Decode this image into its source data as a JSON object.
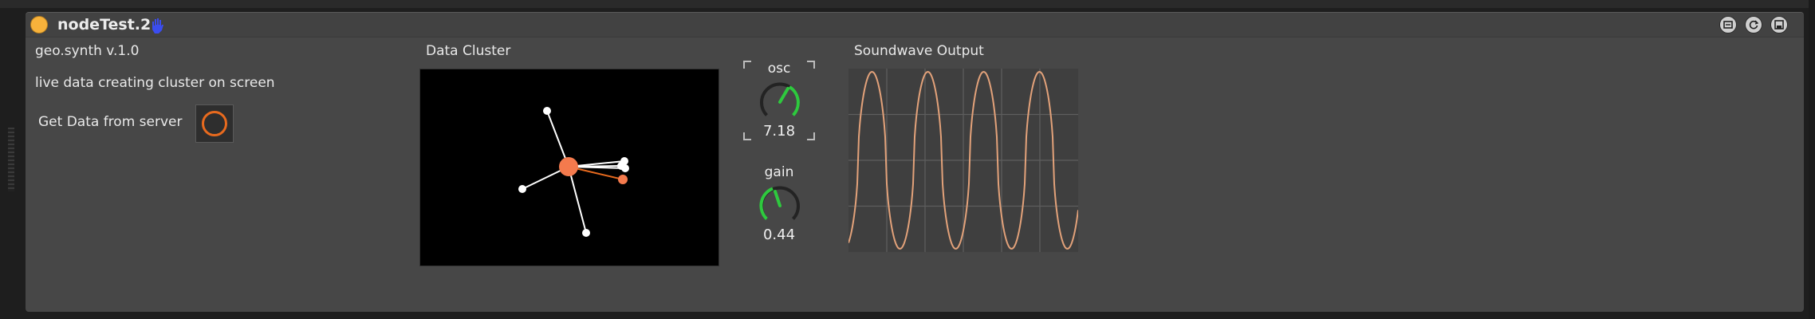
{
  "device": {
    "title": "nodeTest.2",
    "colors": {
      "power": "#f7b23b",
      "accent": "#e86a1e",
      "knob_arc": "#2ec93e",
      "wave": "#e3a27a"
    }
  },
  "info": {
    "name": "geo.synth v.1.0",
    "description": "live data creating cluster on screen",
    "get_data_label": "Get Data from server"
  },
  "cluster": {
    "title": "Data Cluster"
  },
  "dials": {
    "osc": {
      "label": "osc",
      "value": "7.18"
    },
    "gain": {
      "label": "gain",
      "value": "0.44"
    }
  },
  "scope": {
    "title": "Soundwave Output"
  },
  "title_buttons": [
    "fold-icon",
    "refresh-icon",
    "save-icon"
  ]
}
